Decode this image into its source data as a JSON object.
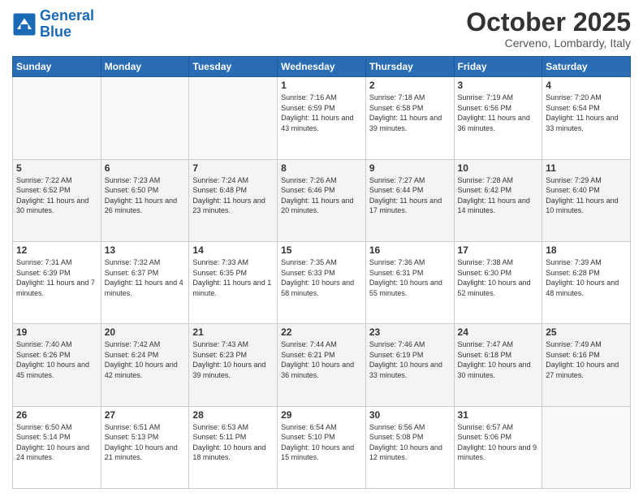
{
  "header": {
    "logo_line1": "General",
    "logo_line2": "Blue",
    "title": "October 2025",
    "subtitle": "Cerveno, Lombardy, Italy"
  },
  "weekdays": [
    "Sunday",
    "Monday",
    "Tuesday",
    "Wednesday",
    "Thursday",
    "Friday",
    "Saturday"
  ],
  "weeks": [
    [
      {
        "day": "",
        "sunrise": "",
        "sunset": "",
        "daylight": ""
      },
      {
        "day": "",
        "sunrise": "",
        "sunset": "",
        "daylight": ""
      },
      {
        "day": "",
        "sunrise": "",
        "sunset": "",
        "daylight": ""
      },
      {
        "day": "1",
        "sunrise": "Sunrise: 7:16 AM",
        "sunset": "Sunset: 6:59 PM",
        "daylight": "Daylight: 11 hours and 43 minutes."
      },
      {
        "day": "2",
        "sunrise": "Sunrise: 7:18 AM",
        "sunset": "Sunset: 6:58 PM",
        "daylight": "Daylight: 11 hours and 39 minutes."
      },
      {
        "day": "3",
        "sunrise": "Sunrise: 7:19 AM",
        "sunset": "Sunset: 6:56 PM",
        "daylight": "Daylight: 11 hours and 36 minutes."
      },
      {
        "day": "4",
        "sunrise": "Sunrise: 7:20 AM",
        "sunset": "Sunset: 6:54 PM",
        "daylight": "Daylight: 11 hours and 33 minutes."
      }
    ],
    [
      {
        "day": "5",
        "sunrise": "Sunrise: 7:22 AM",
        "sunset": "Sunset: 6:52 PM",
        "daylight": "Daylight: 11 hours and 30 minutes."
      },
      {
        "day": "6",
        "sunrise": "Sunrise: 7:23 AM",
        "sunset": "Sunset: 6:50 PM",
        "daylight": "Daylight: 11 hours and 26 minutes."
      },
      {
        "day": "7",
        "sunrise": "Sunrise: 7:24 AM",
        "sunset": "Sunset: 6:48 PM",
        "daylight": "Daylight: 11 hours and 23 minutes."
      },
      {
        "day": "8",
        "sunrise": "Sunrise: 7:26 AM",
        "sunset": "Sunset: 6:46 PM",
        "daylight": "Daylight: 11 hours and 20 minutes."
      },
      {
        "day": "9",
        "sunrise": "Sunrise: 7:27 AM",
        "sunset": "Sunset: 6:44 PM",
        "daylight": "Daylight: 11 hours and 17 minutes."
      },
      {
        "day": "10",
        "sunrise": "Sunrise: 7:28 AM",
        "sunset": "Sunset: 6:42 PM",
        "daylight": "Daylight: 11 hours and 14 minutes."
      },
      {
        "day": "11",
        "sunrise": "Sunrise: 7:29 AM",
        "sunset": "Sunset: 6:40 PM",
        "daylight": "Daylight: 11 hours and 10 minutes."
      }
    ],
    [
      {
        "day": "12",
        "sunrise": "Sunrise: 7:31 AM",
        "sunset": "Sunset: 6:39 PM",
        "daylight": "Daylight: 11 hours and 7 minutes."
      },
      {
        "day": "13",
        "sunrise": "Sunrise: 7:32 AM",
        "sunset": "Sunset: 6:37 PM",
        "daylight": "Daylight: 11 hours and 4 minutes."
      },
      {
        "day": "14",
        "sunrise": "Sunrise: 7:33 AM",
        "sunset": "Sunset: 6:35 PM",
        "daylight": "Daylight: 11 hours and 1 minute."
      },
      {
        "day": "15",
        "sunrise": "Sunrise: 7:35 AM",
        "sunset": "Sunset: 6:33 PM",
        "daylight": "Daylight: 10 hours and 58 minutes."
      },
      {
        "day": "16",
        "sunrise": "Sunrise: 7:36 AM",
        "sunset": "Sunset: 6:31 PM",
        "daylight": "Daylight: 10 hours and 55 minutes."
      },
      {
        "day": "17",
        "sunrise": "Sunrise: 7:38 AM",
        "sunset": "Sunset: 6:30 PM",
        "daylight": "Daylight: 10 hours and 52 minutes."
      },
      {
        "day": "18",
        "sunrise": "Sunrise: 7:39 AM",
        "sunset": "Sunset: 6:28 PM",
        "daylight": "Daylight: 10 hours and 48 minutes."
      }
    ],
    [
      {
        "day": "19",
        "sunrise": "Sunrise: 7:40 AM",
        "sunset": "Sunset: 6:26 PM",
        "daylight": "Daylight: 10 hours and 45 minutes."
      },
      {
        "day": "20",
        "sunrise": "Sunrise: 7:42 AM",
        "sunset": "Sunset: 6:24 PM",
        "daylight": "Daylight: 10 hours and 42 minutes."
      },
      {
        "day": "21",
        "sunrise": "Sunrise: 7:43 AM",
        "sunset": "Sunset: 6:23 PM",
        "daylight": "Daylight: 10 hours and 39 minutes."
      },
      {
        "day": "22",
        "sunrise": "Sunrise: 7:44 AM",
        "sunset": "Sunset: 6:21 PM",
        "daylight": "Daylight: 10 hours and 36 minutes."
      },
      {
        "day": "23",
        "sunrise": "Sunrise: 7:46 AM",
        "sunset": "Sunset: 6:19 PM",
        "daylight": "Daylight: 10 hours and 33 minutes."
      },
      {
        "day": "24",
        "sunrise": "Sunrise: 7:47 AM",
        "sunset": "Sunset: 6:18 PM",
        "daylight": "Daylight: 10 hours and 30 minutes."
      },
      {
        "day": "25",
        "sunrise": "Sunrise: 7:49 AM",
        "sunset": "Sunset: 6:16 PM",
        "daylight": "Daylight: 10 hours and 27 minutes."
      }
    ],
    [
      {
        "day": "26",
        "sunrise": "Sunrise: 6:50 AM",
        "sunset": "Sunset: 5:14 PM",
        "daylight": "Daylight: 10 hours and 24 minutes."
      },
      {
        "day": "27",
        "sunrise": "Sunrise: 6:51 AM",
        "sunset": "Sunset: 5:13 PM",
        "daylight": "Daylight: 10 hours and 21 minutes."
      },
      {
        "day": "28",
        "sunrise": "Sunrise: 6:53 AM",
        "sunset": "Sunset: 5:11 PM",
        "daylight": "Daylight: 10 hours and 18 minutes."
      },
      {
        "day": "29",
        "sunrise": "Sunrise: 6:54 AM",
        "sunset": "Sunset: 5:10 PM",
        "daylight": "Daylight: 10 hours and 15 minutes."
      },
      {
        "day": "30",
        "sunrise": "Sunrise: 6:56 AM",
        "sunset": "Sunset: 5:08 PM",
        "daylight": "Daylight: 10 hours and 12 minutes."
      },
      {
        "day": "31",
        "sunrise": "Sunrise: 6:57 AM",
        "sunset": "Sunset: 5:06 PM",
        "daylight": "Daylight: 10 hours and 9 minutes."
      },
      {
        "day": "",
        "sunrise": "",
        "sunset": "",
        "daylight": ""
      }
    ]
  ]
}
